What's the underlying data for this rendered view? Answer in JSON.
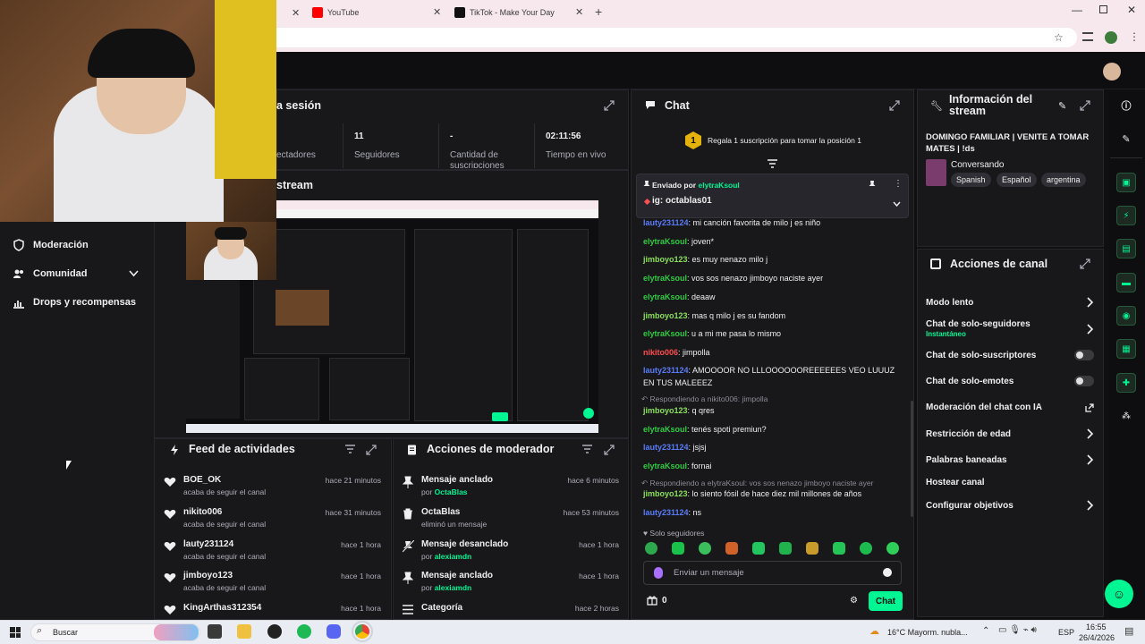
{
  "browser": {
    "tabs": [
      {
        "title": "YouTube",
        "icon": "youtube-icon"
      },
      {
        "title": "TikTok - Make Your Day",
        "icon": "tiktok-icon"
      }
    ]
  },
  "left_nav": {
    "items": [
      {
        "label": "Moderación",
        "icon": "shield-icon"
      },
      {
        "label": "Comunidad",
        "icon": "users-icon"
      },
      {
        "label": "Drops y recompensas",
        "icon": "chart-icon"
      }
    ]
  },
  "session": {
    "title_fragment": "a sesión",
    "stats": [
      {
        "value": "",
        "label": "ectadores"
      },
      {
        "value": "11",
        "label": "Seguidores"
      },
      {
        "value": "-",
        "label": "Cantidad de suscripciones"
      },
      {
        "value": "02:11:56",
        "label": "Tiempo en vivo"
      }
    ]
  },
  "preview": {
    "title_fragment": "stream"
  },
  "activity_feed": {
    "title": "Feed de actividades",
    "items": [
      {
        "name": "BOE_OK",
        "sub": "acaba de seguir el canal",
        "time": "hace 21 minutos"
      },
      {
        "name": "nikito006",
        "sub": "acaba de seguir el canal",
        "time": "hace 31 minutos"
      },
      {
        "name": "lauty231124",
        "sub": "acaba de seguir el canal",
        "time": "hace 1 hora"
      },
      {
        "name": "jimboyo123",
        "sub": "acaba de seguir el canal",
        "time": "hace 1 hora"
      },
      {
        "name": "KingArthas312354",
        "sub": "",
        "time": "hace 1 hora"
      }
    ]
  },
  "mod_actions": {
    "title": "Acciones de moderador",
    "items": [
      {
        "name": "Mensaje anclado",
        "prefix": "por",
        "user": "OctaBlas",
        "time": "hace 6 minutos",
        "icon": "pin-icon"
      },
      {
        "name": "OctaBlas",
        "prefix": "eliminó un mensaje",
        "user": "",
        "time": "hace 53 minutos",
        "icon": "trash-icon"
      },
      {
        "name": "Mensaje desanclado",
        "prefix": "por",
        "user": "alexiamdn",
        "time": "hace 1 hora",
        "icon": "unpin-icon"
      },
      {
        "name": "Mensaje anclado",
        "prefix": "por",
        "user": "alexiamdn",
        "time": "hace 1 hora",
        "icon": "pin-icon"
      },
      {
        "name": "Categoría",
        "prefix": "",
        "user": "",
        "time": "hace 2 horas",
        "icon": "category-icon"
      }
    ]
  },
  "chat": {
    "title": "Chat",
    "gift_banner": "Regala 1 suscripción para tomar la posición 1",
    "gift_rank": "1",
    "pinned_by_label": "Enviado por",
    "pinned_by_user": "elytraKsoul",
    "pinned_message": "ig: octablas01",
    "messages": [
      {
        "user": "lauty231124",
        "color": "#5b7cfa",
        "text": ": mi canción favorita de milo j es niño"
      },
      {
        "user": "elytraKsoul",
        "color": "#2ecc40",
        "text": ": joven*"
      },
      {
        "user": "jimboyo123",
        "color": "#8be05a",
        "text": ": es muy nenazo milo j"
      },
      {
        "user": "elytraKsoul",
        "color": "#2ecc40",
        "text": ": vos sos nenazo jimboyo naciste ayer"
      },
      {
        "user": "elytraKsoul",
        "color": "#2ecc40",
        "text": ": deaaw"
      },
      {
        "user": "jimboyo123",
        "color": "#8be05a",
        "text": ": mas q milo j es su fandom"
      },
      {
        "user": "elytraKsoul",
        "color": "#2ecc40",
        "text": ": u a mi me pasa lo mismo"
      },
      {
        "user": "nikito006",
        "color": "#ff4d4d",
        "text": ": jimpolla"
      },
      {
        "user": "lauty231124",
        "color": "#5b7cfa",
        "text": ": AMOOOOR NO LLLOOOOOOREEEEEES VEO LUUUZ EN TUS MALEEEZ"
      },
      {
        "user": "jimboyo123",
        "color": "#8be05a",
        "text": ": q qres",
        "reply": "Respondiendo a nikito006: jimpolla"
      },
      {
        "user": "elytraKsoul",
        "color": "#2ecc40",
        "text": ": tenés spoti premiun?"
      },
      {
        "user": "lauty231124",
        "color": "#5b7cfa",
        "text": ": jsjsj"
      },
      {
        "user": "elytraKsoul",
        "color": "#2ecc40",
        "text": ": fornai"
      },
      {
        "user": "jimboyo123",
        "color": "#8be05a",
        "text": ": lo siento fósil de hace diez mil millones de años",
        "reply": "Respondiendo a elytraKsoul: vos sos nenazo jimboyo naciste ayer"
      },
      {
        "user": "lauty231124",
        "color": "#5b7cfa",
        "text": ": ns"
      }
    ],
    "mode_notice": "Solo seguidores",
    "input_placeholder": "Enviar un mensaje",
    "points": "0",
    "send_label": "Chat"
  },
  "stream_info": {
    "title": "Información del stream",
    "stream_title": "DOMINGO FAMILIAR | VENITE A TOMAR MATES | !ds",
    "category": "Conversando",
    "tags": [
      "Spanish",
      "Español",
      "argentina"
    ]
  },
  "channel_actions": {
    "title": "Acciones de canal",
    "items": [
      {
        "label": "Modo lento",
        "control": "chevron",
        "sub": ""
      },
      {
        "label": "Chat de solo-seguidores",
        "control": "chevron",
        "sub": "Instantáneo"
      },
      {
        "label": "Chat de solo-suscriptores",
        "control": "toggle",
        "sub": ""
      },
      {
        "label": "Chat de solo-emotes",
        "control": "toggle",
        "sub": ""
      },
      {
        "label": "Moderación del chat con IA",
        "control": "external",
        "sub": ""
      },
      {
        "label": "Restricción de edad",
        "control": "chevron",
        "sub": ""
      },
      {
        "label": "Palabras baneadas",
        "control": "chevron",
        "sub": ""
      },
      {
        "label": "Hostear canal",
        "control": "none",
        "sub": ""
      },
      {
        "label": "Configurar objetivos",
        "control": "chevron",
        "sub": ""
      }
    ]
  },
  "taskbar": {
    "search": "Buscar",
    "weather": "16°C  Mayorm. nubla...",
    "lang": "ESP",
    "time": "16:55",
    "date": "26/4/2026"
  },
  "colors": {
    "accent": "#00f593",
    "bg": "#0e0e10",
    "panel": "#18181b"
  }
}
